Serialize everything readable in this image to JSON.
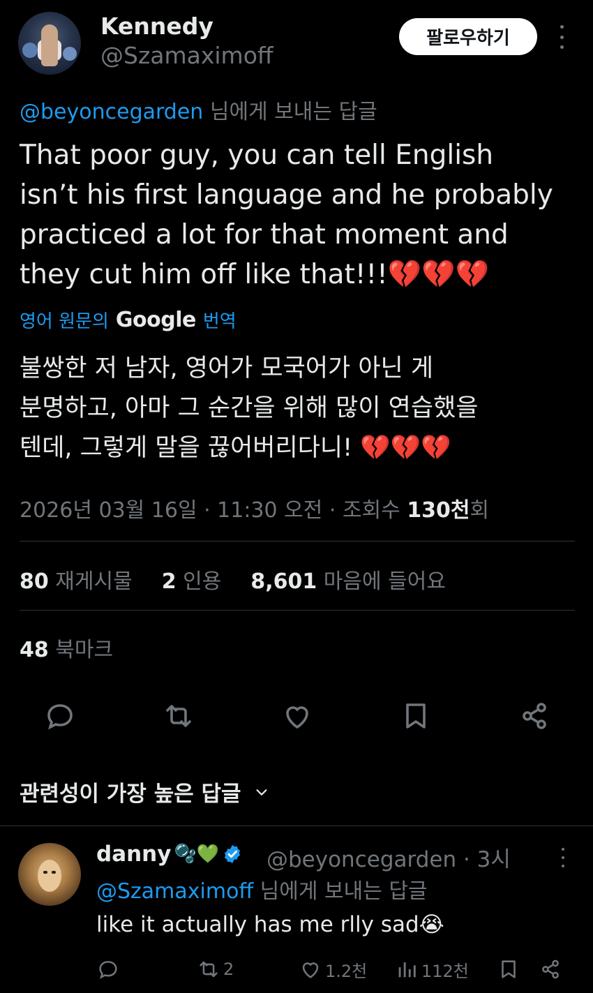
{
  "author": {
    "name": "Kennedy",
    "handle": "@Szamaximoff",
    "follow_label": "팔로우하기"
  },
  "tweet": {
    "reply_to_handle": "@beyoncegarden",
    "reply_to_suffix": " 님에게 보내는 답글",
    "text": "That poor guy, you can tell English\nisn’t his first language and he probably\npracticed a lot for that moment and\nthey cut him off like that!!!💔💔💔",
    "translate_prefix": "영어 원문의",
    "translate_brand": "Google",
    "translate_suffix": "번역",
    "translated_text": "불쌍한 저 남자, 영어가 모국어가 아닌 게\n분명하고, 아마 그 순간을 위해 많이 연습했을\n텐데, 그렇게 말을 끊어버리다니! 💔💔💔",
    "timestamp": "2026년 03월 16일 · 11:30 오전 · 조회수 ",
    "views_count": "130천",
    "views_suffix": "회"
  },
  "stats": {
    "reposts_count": "80",
    "reposts_label": "재게시물",
    "quotes_count": "2",
    "quotes_label": "인용",
    "likes_count": "8,601",
    "likes_label": "마음에 들어요",
    "bookmarks_count": "48",
    "bookmarks_label": "북마크"
  },
  "replies_section": {
    "sort_label": "관련성이 가장 높은 답글"
  },
  "reply": {
    "name": "danny",
    "name_emojis": "🫧💚",
    "handle_time": "@beyoncegarden · 3시",
    "reply_to_handle": "@Szamaximoff",
    "reply_to_suffix": " 님에게 보내는 답글",
    "text": "like it actually has me rlly sad😭",
    "retweets": "2",
    "likes": "1.2천",
    "views": "112천"
  },
  "colors": {
    "background": "#000000",
    "text": "#e7e9ea",
    "muted": "#71767b",
    "link": "#1d9bf0",
    "verified": "#1d9bf0"
  }
}
